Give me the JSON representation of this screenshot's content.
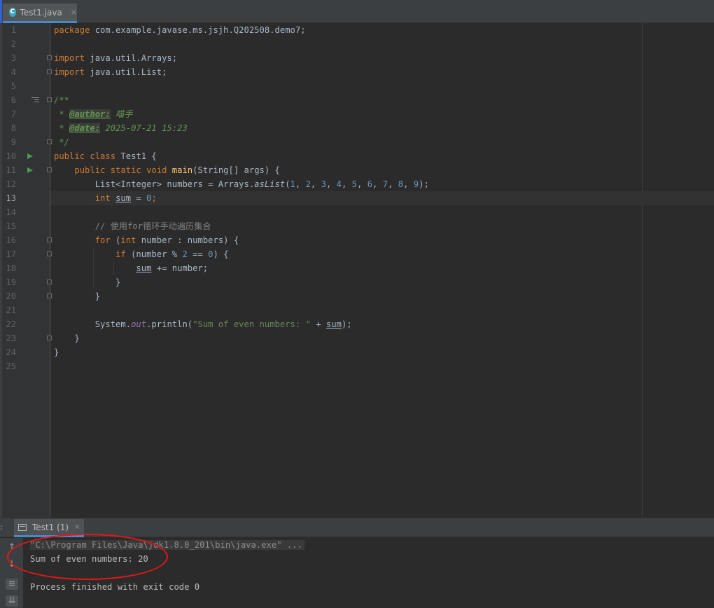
{
  "editor_tab": {
    "label": "Test1.java",
    "icon": "java-class-icon",
    "close": "×"
  },
  "current_line": 13,
  "lines": [
    {
      "n": "1"
    },
    {
      "n": "2"
    },
    {
      "n": "3"
    },
    {
      "n": "4"
    },
    {
      "n": "5"
    },
    {
      "n": "6"
    },
    {
      "n": "7"
    },
    {
      "n": "8"
    },
    {
      "n": "9"
    },
    {
      "n": "10"
    },
    {
      "n": "11"
    },
    {
      "n": "12"
    },
    {
      "n": "13"
    },
    {
      "n": "14"
    },
    {
      "n": "15"
    },
    {
      "n": "16"
    },
    {
      "n": "17"
    },
    {
      "n": "18"
    },
    {
      "n": "19"
    },
    {
      "n": "20"
    },
    {
      "n": "21"
    },
    {
      "n": "22"
    },
    {
      "n": "23"
    },
    {
      "n": "24"
    },
    {
      "n": "25"
    }
  ],
  "code": {
    "l1_kw": "package",
    "l1_rest": " com.example.javase.ms.jsjh.Q202508.demo7;",
    "l3_kw": "import",
    "l3_rest": " java.util.Arrays;",
    "l4_kw": "import",
    "l4_rest": " java.util.List;",
    "l6": "/**",
    "l7_pre": " * ",
    "l7_tag": "@author:",
    "l7_val": " 喵手",
    "l8_pre": " * ",
    "l8_tag": "@date:",
    "l8_val": " 2025-07-21 15:23",
    "l9": " */",
    "l10_kw": "public class",
    "l10_rest": " Test1 {",
    "l11_ind": "    ",
    "l11_kw": "public static void",
    "l11_fn": "main",
    "l11_rest": "(String[] args) {",
    "l12_ind": "        ",
    "l12_a": "List<Integer> numbers = Arrays.",
    "l12_m": "asList",
    "l12_b": "(",
    "l12_nums": [
      "1",
      "2",
      "3",
      "4",
      "5",
      "6",
      "7",
      "8",
      "9"
    ],
    "l12_end": ");",
    "l13_ind": "        ",
    "l13_kw": "int",
    "l13_var": "sum",
    "l13_eq": " = ",
    "l13_num": "0",
    "l13_end": ";",
    "l15_ind": "        ",
    "l15_cmt": "// 使用for循环手动遍历集合",
    "l16_ind": "        ",
    "l16_kw": "for",
    "l16_a": " (",
    "l16_kw2": "int",
    "l16_b": " number : numbers) {",
    "l17_ind": "            ",
    "l17_kw": "if",
    "l17_a": " (number % ",
    "l17_n1": "2",
    "l17_b": " == ",
    "l17_n2": "0",
    "l17_c": ") {",
    "l18_ind": "                ",
    "l18_var": "sum",
    "l18_rest": " += number;",
    "l19": "            }",
    "l20": "        }",
    "l22_ind": "        ",
    "l22_a": "System.",
    "l22_out": "out",
    "l22_b": ".println(",
    "l22_str": "\"Sum of even numbers: \"",
    "l22_c": " + ",
    "l22_var": "sum",
    "l22_d": ");",
    "l23": "    }",
    "l24": "}"
  },
  "run_panel": {
    "prefix": ":",
    "tab_label": "Test1 (1)",
    "tab_close": "×",
    "command": "\"C:\\Program Files\\Java\\jdk1.8.0_201\\bin\\java.exe\" ...",
    "output": "Sum of even numbers: 20",
    "finish": "Process finished with exit code 0",
    "tools": [
      "arrow-up-icon",
      "arrow-down-icon",
      "soft-wrap-icon",
      "scroll-to-end-icon"
    ]
  },
  "colors": {
    "background": "#2b2b2b",
    "keyword": "#cc7832",
    "number": "#6897bb",
    "string": "#6a8759",
    "annotation_circle": "#e01818"
  }
}
